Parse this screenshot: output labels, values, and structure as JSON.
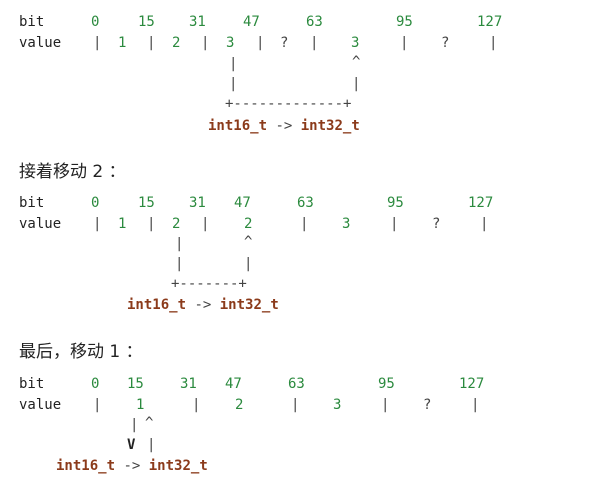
{
  "labels": {
    "bit": "bit",
    "value": "value"
  },
  "section1": {
    "bits": [
      "0",
      "15",
      "31",
      "47",
      "63",
      "95",
      "127"
    ],
    "values": [
      "1",
      "2",
      "3",
      "?",
      "3",
      "?"
    ],
    "arrow_up": "^",
    "dash_line": "+-------------+",
    "conversion_from": "int16_t",
    "conversion_op": "->",
    "conversion_to": "int32_t"
  },
  "section2": {
    "heading": "接着移动 2 ：",
    "bits": [
      "0",
      "15",
      "31",
      "47",
      "63",
      "95",
      "127"
    ],
    "values": [
      "1",
      "2",
      "2",
      "3",
      "?"
    ],
    "arrow_up": "^",
    "dash_line": "+-------+",
    "conversion_from": "int16_t",
    "conversion_op": "->",
    "conversion_to": "int32_t"
  },
  "section3": {
    "heading": "最后，移动 1 ：",
    "bits": [
      "0",
      "15",
      "31",
      "47",
      "63",
      "95",
      "127"
    ],
    "values": [
      "1",
      "2",
      "3",
      "?"
    ],
    "arrow_up": "^",
    "arrow_down": "V",
    "conversion_from": "int16_t",
    "conversion_op": "->",
    "conversion_to": "int32_t"
  },
  "colors": {
    "number": "#2b8a3e",
    "type": "#8b3a1a",
    "text": "#222222"
  }
}
